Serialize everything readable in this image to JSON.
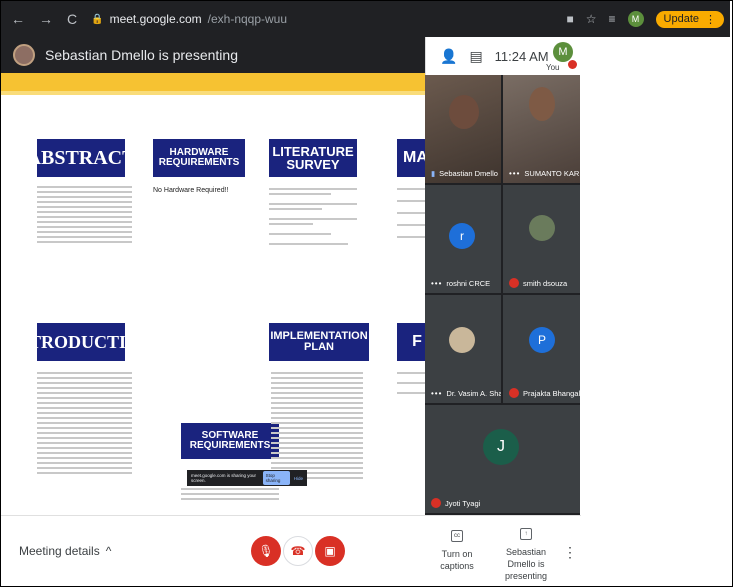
{
  "browser": {
    "url_host": "meet.google.com",
    "url_path": "/exh-nqqp-wuu",
    "profile_initial": "M",
    "update_label": "Update"
  },
  "presenter_bar": {
    "text": "Sebastian Dmello is presenting"
  },
  "top_panel": {
    "time": "11:24 AM",
    "self_initial": "M",
    "self_label": "You"
  },
  "slide": {
    "headings": {
      "abstract": "ABSTRACT",
      "hardware": "HARDWARE REQUIREMENTS",
      "literature": "LITERATURE SURVEY",
      "mark": "MARK",
      "introduction": "INTRODUCTION",
      "implementation": "IMPLEMENTATION PLAN",
      "software": "SOFTWARE REQUIREMENTS",
      "f": "F"
    },
    "no_hardware": "No Hardware Required!!",
    "share_notice": "meet.google.com is sharing your screen.",
    "stop_sharing": "Stop sharing",
    "hide": "Hide"
  },
  "participants": [
    {
      "name": "Sebastian Dmello",
      "type": "video"
    },
    {
      "name": "SUMANTO KAR",
      "type": "video"
    },
    {
      "name": "roshni CRCE",
      "initial": "r",
      "color": "#1e6fd9"
    },
    {
      "name": "smith dsouza",
      "type": "photo"
    },
    {
      "name": "Dr. Vasim A. Shaikh",
      "type": "photo"
    },
    {
      "name": "Prajakta Bhangale C...",
      "initial": "P",
      "color": "#1e6fd9"
    },
    {
      "name": "Jyoti Tyagi",
      "initial": "J",
      "color": "#1b5e4a"
    }
  ],
  "bottom": {
    "meeting_details": "Meeting details",
    "captions_label": "Turn on captions",
    "presenting_label": "Sebastian Dmello is presenting"
  }
}
